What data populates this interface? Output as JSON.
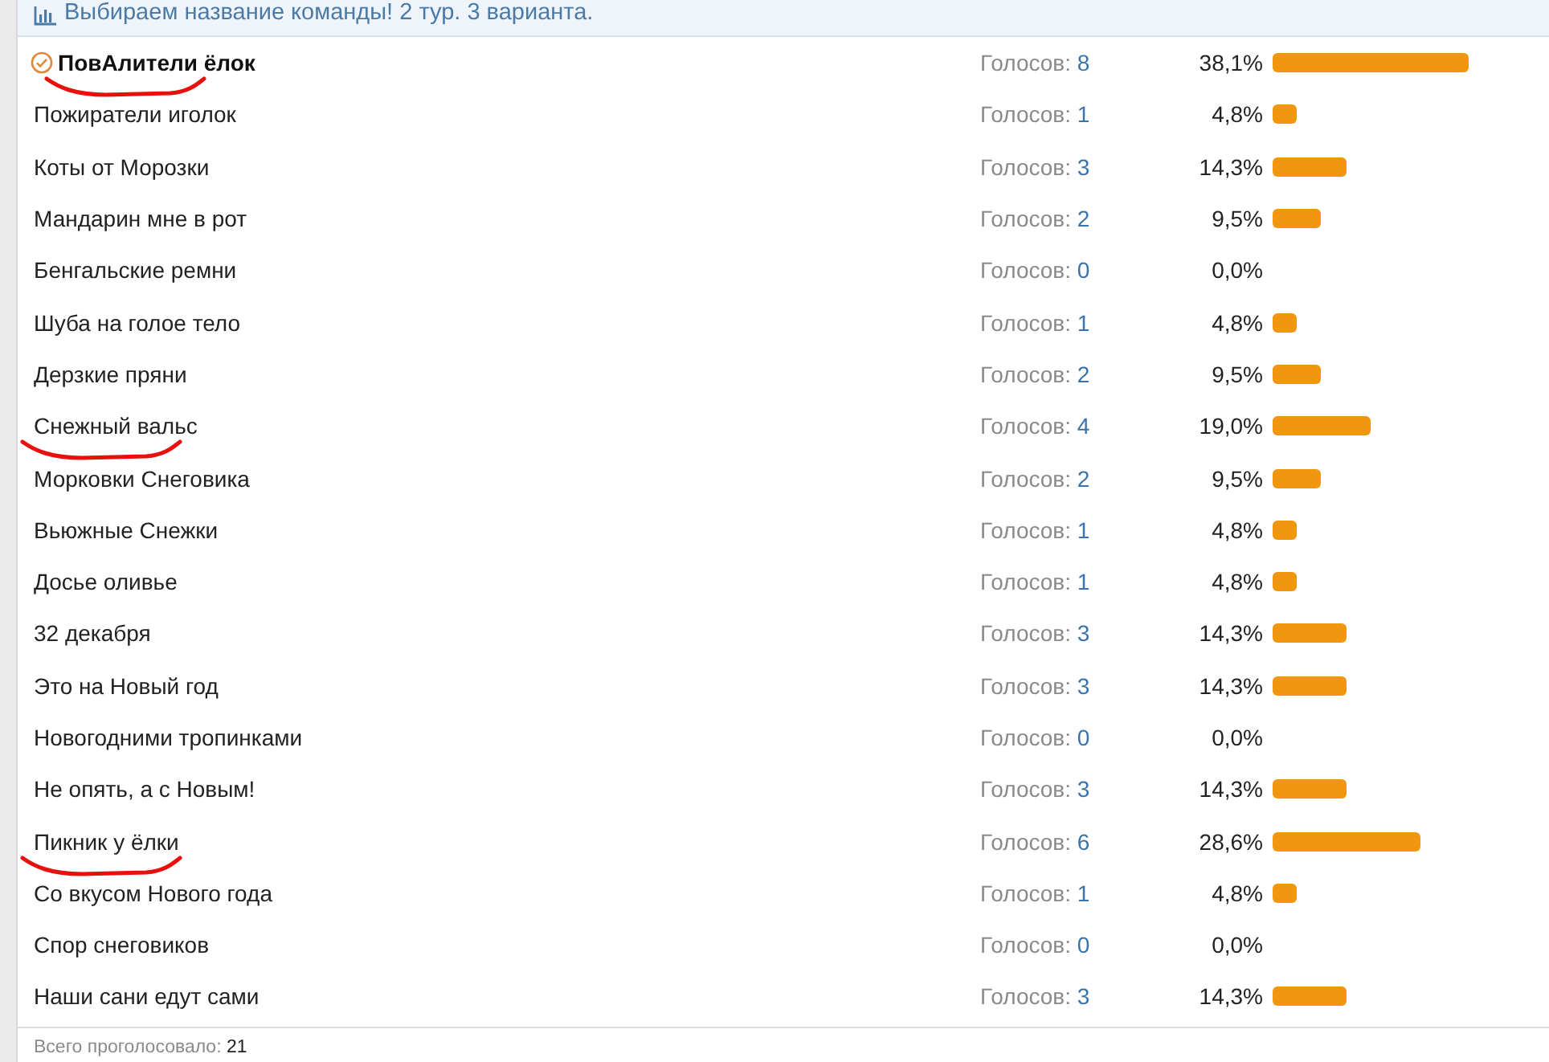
{
  "poll": {
    "title": "Выбираем название команды! 2 тур. 3 варианта.",
    "options": [
      {
        "name": "ПовАлители ёлок",
        "selected": true,
        "marked": true,
        "votes_label": "Голосов:",
        "votes": "8",
        "percent": "38,1%"
      },
      {
        "name": "Пожиратели иголок",
        "selected": false,
        "marked": false,
        "votes_label": "Голосов:",
        "votes": "1",
        "percent": "4,8%"
      },
      {
        "name": "Коты от Морозки",
        "selected": false,
        "marked": false,
        "votes_label": "Голосов:",
        "votes": "3",
        "percent": "14,3%"
      },
      {
        "name": "Мандарин мне в рот",
        "selected": false,
        "marked": false,
        "votes_label": "Голосов:",
        "votes": "2",
        "percent": "9,5%"
      },
      {
        "name": "Бенгальские ремни",
        "selected": false,
        "marked": false,
        "votes_label": "Голосов:",
        "votes": "0",
        "percent": "0,0%"
      },
      {
        "name": "Шуба на голое тело",
        "selected": false,
        "marked": false,
        "votes_label": "Голосов:",
        "votes": "1",
        "percent": "4,8%"
      },
      {
        "name": "Дерзкие пряни",
        "selected": false,
        "marked": false,
        "votes_label": "Голосов:",
        "votes": "2",
        "percent": "9,5%"
      },
      {
        "name": "Снежный вальс",
        "selected": false,
        "marked": true,
        "votes_label": "Голосов:",
        "votes": "4",
        "percent": "19,0%"
      },
      {
        "name": "Морковки Снеговика",
        "selected": false,
        "marked": false,
        "votes_label": "Голосов:",
        "votes": "2",
        "percent": "9,5%"
      },
      {
        "name": "Вьюжные Снежки",
        "selected": false,
        "marked": false,
        "votes_label": "Голосов:",
        "votes": "1",
        "percent": "4,8%"
      },
      {
        "name": "Досье оливье",
        "selected": false,
        "marked": false,
        "votes_label": "Голосов:",
        "votes": "1",
        "percent": "4,8%"
      },
      {
        "name": "32 декабря",
        "selected": false,
        "marked": false,
        "votes_label": "Голосов:",
        "votes": "3",
        "percent": "14,3%"
      },
      {
        "name": "Это на Новый год",
        "selected": false,
        "marked": false,
        "votes_label": "Голосов:",
        "votes": "3",
        "percent": "14,3%"
      },
      {
        "name": "Новогодними тропинками",
        "selected": false,
        "marked": false,
        "votes_label": "Голосов:",
        "votes": "0",
        "percent": "0,0%"
      },
      {
        "name": "Не опять, а с Новым!",
        "selected": false,
        "marked": false,
        "votes_label": "Голосов:",
        "votes": "3",
        "percent": "14,3%"
      },
      {
        "name": "Пикник у ёлки",
        "selected": false,
        "marked": true,
        "votes_label": "Голосов:",
        "votes": "6",
        "percent": "28,6%"
      },
      {
        "name": "Со вкусом Нового года",
        "selected": false,
        "marked": false,
        "votes_label": "Голосов:",
        "votes": "1",
        "percent": "4,8%"
      },
      {
        "name": "Спор снеговиков",
        "selected": false,
        "marked": false,
        "votes_label": "Голосов:",
        "votes": "0",
        "percent": "0,0%"
      },
      {
        "name": "Наши сани едут сами",
        "selected": false,
        "marked": false,
        "votes_label": "Голосов:",
        "votes": "3",
        "percent": "14,3%"
      }
    ],
    "total_label": "Всего проголосовало:",
    "total": "21"
  }
}
